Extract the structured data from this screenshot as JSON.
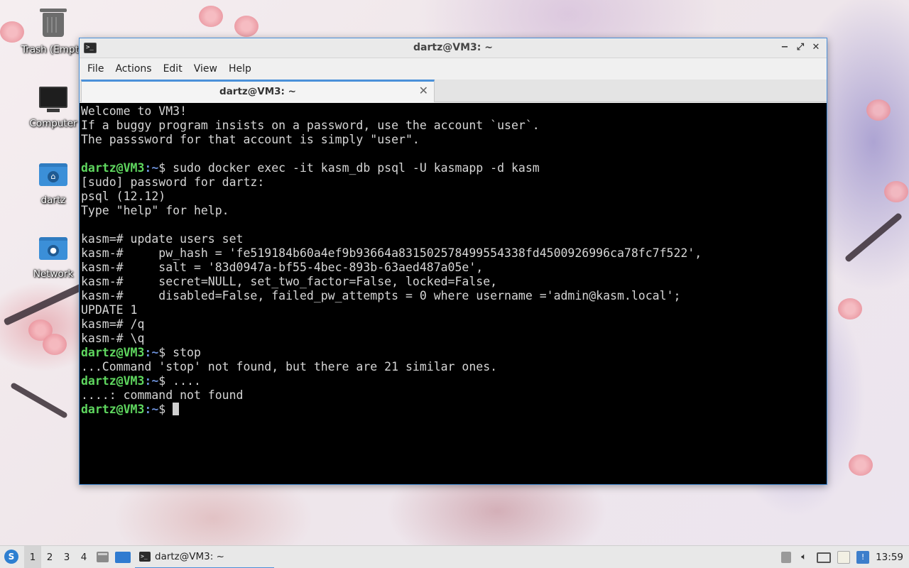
{
  "desktop": {
    "icons": [
      {
        "label": "Trash (Empty)",
        "icon": "trash-icon"
      },
      {
        "label": "Computer",
        "icon": "computer-icon"
      },
      {
        "label": "dartz",
        "icon": "home-folder-icon"
      },
      {
        "label": "Network",
        "icon": "network-folder-icon"
      }
    ]
  },
  "window": {
    "title": "dartz@VM3: ~",
    "controls": {
      "minimize": "−",
      "maximize": "⤢",
      "close": "✕"
    },
    "menu": [
      "File",
      "Actions",
      "Edit",
      "View",
      "Help"
    ],
    "tab": {
      "label": "dartz@VM3: ~",
      "close": "✕"
    }
  },
  "terminal": {
    "prompt_user": "dartz@VM3",
    "prompt_path": ":~",
    "prompt_sign": "$ ",
    "lines": [
      {
        "type": "text",
        "text": "Welcome to VM3!"
      },
      {
        "type": "text",
        "text": "If a buggy program insists on a password, use the account `user`."
      },
      {
        "type": "text",
        "text": "The passsword for that account is simply \"user\"."
      },
      {
        "type": "text",
        "text": ""
      },
      {
        "type": "prompt",
        "cmd": "sudo docker exec -it kasm_db psql -U kasmapp -d kasm"
      },
      {
        "type": "text",
        "text": "[sudo] password for dartz:"
      },
      {
        "type": "text",
        "text": "psql (12.12)"
      },
      {
        "type": "text",
        "text": "Type \"help\" for help."
      },
      {
        "type": "text",
        "text": ""
      },
      {
        "type": "text",
        "text": "kasm=# update users set"
      },
      {
        "type": "text",
        "text": "kasm-#     pw_hash = 'fe519184b60a4ef9b93664a831502578499554338fd4500926996ca78fc7f522',"
      },
      {
        "type": "text",
        "text": "kasm-#     salt = '83d0947a-bf55-4bec-893b-63aed487a05e',"
      },
      {
        "type": "text",
        "text": "kasm-#     secret=NULL, set_two_factor=False, locked=False,"
      },
      {
        "type": "text",
        "text": "kasm-#     disabled=False, failed_pw_attempts = 0 where username ='admin@kasm.local';"
      },
      {
        "type": "text",
        "text": "UPDATE 1"
      },
      {
        "type": "text",
        "text": "kasm=# /q"
      },
      {
        "type": "text",
        "text": "kasm-# \\q"
      },
      {
        "type": "prompt",
        "cmd": "stop"
      },
      {
        "type": "text",
        "text": "...Command 'stop' not found, but there are 21 similar ones."
      },
      {
        "type": "prompt",
        "cmd": "...."
      },
      {
        "type": "text",
        "text": "....: command not found"
      },
      {
        "type": "prompt",
        "cmd": "",
        "cursor": true
      }
    ]
  },
  "taskbar": {
    "start_icon": "start-menu-icon",
    "workspaces": [
      "1",
      "2",
      "3",
      "4"
    ],
    "active_workspace": "1",
    "task": "dartz@VM3: ~",
    "clock": "13:59"
  },
  "colors": {
    "accent": "#4a90d9",
    "prompt_user": "#5fd75f",
    "prompt_path": "#6b8fd6",
    "terminal_bg": "#000000"
  }
}
